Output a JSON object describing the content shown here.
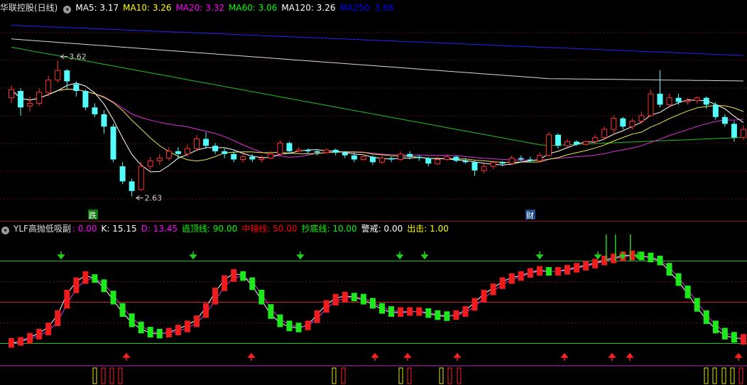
{
  "main_panel": {
    "title": "华联控股(日线)",
    "indicators": [
      {
        "label": "MA5: 3.17",
        "color": "#ffffff"
      },
      {
        "label": "MA10: 3.26",
        "color": "#ffff00"
      },
      {
        "label": "MA20: 3.32",
        "color": "#ff00ff"
      },
      {
        "label": "MA60: 3.06",
        "color": "#00ff00"
      },
      {
        "label": "MA120: 3.26",
        "color": "#ffffff"
      },
      {
        "label": "MA250: 3.66",
        "color": "#0000ff"
      }
    ],
    "annotations": {
      "high": "3.62",
      "low": "2.63",
      "mark_die": "跌",
      "mark_cai": "财"
    }
  },
  "indicator_panel": {
    "name": "YLF高抛低吸副",
    "values": [
      {
        "label": ": 0.00",
        "color": "#ff00ff"
      },
      {
        "label": "K: 15.15",
        "color": "#ffffff"
      },
      {
        "label": "D: 13.45",
        "color": "#ff00ff"
      },
      {
        "label": "逃顶线: 90.00",
        "color": "#00ff00"
      },
      {
        "label": "中轴线: 50.00",
        "color": "#ff0000"
      },
      {
        "label": "抄底线: 10.00",
        "color": "#00ff00"
      },
      {
        "label": "警戒: 0.00",
        "color": "#ffffff"
      },
      {
        "label": "出击: 1.00",
        "color": "#ffff00"
      }
    ]
  },
  "chart_data": [
    {
      "type": "candlestick",
      "title": "华联控股(日线)",
      "ylim": [
        2.55,
        3.95
      ],
      "candles": [
        [
          3.35,
          3.41,
          3.44,
          3.31
        ],
        [
          3.4,
          3.28,
          3.42,
          3.22
        ],
        [
          3.29,
          3.31,
          3.36,
          3.25
        ],
        [
          3.31,
          3.39,
          3.42,
          3.29
        ],
        [
          3.39,
          3.48,
          3.51,
          3.36
        ],
        [
          3.48,
          3.55,
          3.62,
          3.46
        ],
        [
          3.55,
          3.47,
          3.56,
          3.41
        ],
        [
          3.45,
          3.4,
          3.47,
          3.36
        ],
        [
          3.4,
          3.28,
          3.41,
          3.26
        ],
        [
          3.28,
          3.23,
          3.31,
          3.21
        ],
        [
          3.23,
          3.14,
          3.26,
          3.09
        ],
        [
          3.14,
          2.9,
          3.16,
          2.88
        ],
        [
          2.85,
          2.74,
          2.88,
          2.72
        ],
        [
          2.74,
          2.67,
          2.76,
          2.63
        ],
        [
          2.68,
          2.85,
          2.88,
          2.67
        ],
        [
          2.85,
          2.89,
          2.92,
          2.82
        ],
        [
          2.89,
          2.91,
          2.94,
          2.86
        ],
        [
          2.91,
          2.96,
          2.99,
          2.89
        ],
        [
          2.96,
          2.94,
          2.99,
          2.91
        ],
        [
          2.94,
          2.98,
          3.01,
          2.92
        ],
        [
          2.98,
          3.05,
          3.08,
          2.96
        ],
        [
          3.05,
          3.0,
          3.1,
          2.98
        ],
        [
          3.0,
          2.96,
          3.02,
          2.94
        ],
        [
          2.96,
          2.94,
          2.98,
          2.91
        ],
        [
          2.94,
          2.9,
          2.96,
          2.88
        ],
        [
          2.9,
          2.92,
          2.94,
          2.88
        ],
        [
          2.92,
          2.9,
          2.94,
          2.88
        ],
        [
          2.9,
          2.91,
          2.93,
          2.88
        ],
        [
          2.91,
          2.94,
          2.96,
          2.9
        ],
        [
          2.94,
          3.02,
          3.04,
          2.93
        ],
        [
          3.02,
          2.96,
          3.03,
          2.94
        ],
        [
          2.96,
          2.97,
          2.99,
          2.95
        ],
        [
          2.97,
          2.96,
          2.98,
          2.94
        ],
        [
          2.96,
          2.95,
          2.97,
          2.93
        ],
        [
          2.95,
          2.97,
          2.98,
          2.94
        ],
        [
          2.97,
          2.95,
          2.98,
          2.93
        ],
        [
          2.95,
          2.93,
          2.96,
          2.91
        ],
        [
          2.93,
          2.9,
          2.95,
          2.88
        ],
        [
          2.9,
          2.92,
          2.94,
          2.89
        ],
        [
          2.92,
          2.88,
          2.93,
          2.86
        ],
        [
          2.88,
          2.91,
          2.93,
          2.87
        ],
        [
          2.91,
          2.9,
          2.92,
          2.88
        ],
        [
          2.9,
          2.94,
          2.96,
          2.89
        ],
        [
          2.94,
          2.92,
          2.96,
          2.9
        ],
        [
          2.92,
          2.91,
          2.93,
          2.89
        ],
        [
          2.91,
          2.87,
          2.92,
          2.85
        ],
        [
          2.87,
          2.9,
          2.92,
          2.86
        ],
        [
          2.9,
          2.92,
          2.93,
          2.89
        ],
        [
          2.92,
          2.89,
          2.93,
          2.88
        ],
        [
          2.89,
          2.88,
          2.91,
          2.87
        ],
        [
          2.88,
          2.82,
          2.89,
          2.78
        ],
        [
          2.82,
          2.85,
          2.87,
          2.8
        ],
        [
          2.85,
          2.88,
          2.89,
          2.83
        ],
        [
          2.88,
          2.87,
          2.89,
          2.85
        ],
        [
          2.87,
          2.91,
          2.93,
          2.86
        ],
        [
          2.91,
          2.9,
          2.93,
          2.89
        ],
        [
          2.9,
          2.89,
          2.92,
          2.88
        ],
        [
          2.89,
          2.93,
          2.95,
          2.88
        ],
        [
          2.93,
          3.08,
          3.1,
          2.92
        ],
        [
          3.08,
          3.0,
          3.09,
          2.98
        ],
        [
          3.0,
          3.03,
          3.05,
          2.99
        ],
        [
          3.03,
          3.01,
          3.04,
          3.0
        ],
        [
          3.01,
          3.03,
          3.04,
          3.0
        ],
        [
          3.03,
          3.06,
          3.08,
          3.02
        ],
        [
          3.06,
          3.12,
          3.14,
          3.04
        ],
        [
          3.12,
          3.2,
          3.22,
          3.08
        ],
        [
          3.2,
          3.14,
          3.21,
          3.12
        ],
        [
          3.14,
          3.18,
          3.2,
          3.12
        ],
        [
          3.18,
          3.22,
          3.25,
          3.16
        ],
        [
          3.22,
          3.38,
          3.41,
          3.21
        ],
        [
          3.38,
          3.3,
          3.55,
          3.28
        ],
        [
          3.3,
          3.35,
          3.38,
          3.28
        ],
        [
          3.35,
          3.32,
          3.38,
          3.3
        ],
        [
          3.32,
          3.33,
          3.35,
          3.3
        ],
        [
          3.33,
          3.35,
          3.36,
          3.31
        ],
        [
          3.35,
          3.3,
          3.36,
          3.27
        ],
        [
          3.3,
          3.21,
          3.32,
          3.19
        ],
        [
          3.21,
          3.16,
          3.23,
          3.14
        ],
        [
          3.16,
          3.06,
          3.18,
          3.03
        ],
        [
          3.06,
          3.12,
          3.15,
          3.04
        ]
      ]
    },
    {
      "type": "line",
      "title": "YLF高抛低吸副",
      "ylim": [
        -10,
        105
      ],
      "series": [
        {
          "name": "K",
          "values": [
            10,
            12,
            16,
            20,
            26,
            38,
            58,
            70,
            76,
            73,
            64,
            52,
            40,
            30,
            24,
            20,
            19,
            21,
            24,
            28,
            33,
            45,
            60,
            72,
            78,
            76,
            66,
            52,
            38,
            30,
            26,
            25,
            28,
            38,
            48,
            54,
            56,
            55,
            52,
            48,
            43,
            40,
            40,
            41,
            41,
            39,
            37,
            36,
            38,
            42,
            50,
            58,
            64,
            70,
            74,
            76,
            79,
            81,
            80,
            80,
            82,
            84,
            86,
            88,
            91,
            93,
            95,
            96,
            95,
            93,
            90,
            80,
            70,
            58,
            45,
            33,
            24,
            18,
            15,
            15
          ]
        },
        {
          "name": "D",
          "values": [
            11,
            12,
            14,
            18,
            22,
            31,
            48,
            63,
            72,
            73,
            68,
            57,
            45,
            35,
            27,
            22,
            20,
            20,
            22,
            25,
            30,
            39,
            52,
            65,
            74,
            75,
            70,
            58,
            44,
            34,
            28,
            26,
            27,
            34,
            44,
            51,
            54,
            55,
            54,
            50,
            45,
            42,
            41,
            41,
            41,
            40,
            38,
            37,
            37,
            40,
            46,
            54,
            61,
            67,
            72,
            75,
            78,
            80,
            80,
            80,
            81,
            83,
            85,
            87,
            90,
            92,
            94,
            95,
            95,
            94,
            91,
            84,
            74,
            62,
            50,
            38,
            28,
            21,
            17,
            13
          ]
        }
      ],
      "levels": {
        "逃顶线": 90,
        "中轴线": 50,
        "抄底线": 10
      }
    }
  ]
}
